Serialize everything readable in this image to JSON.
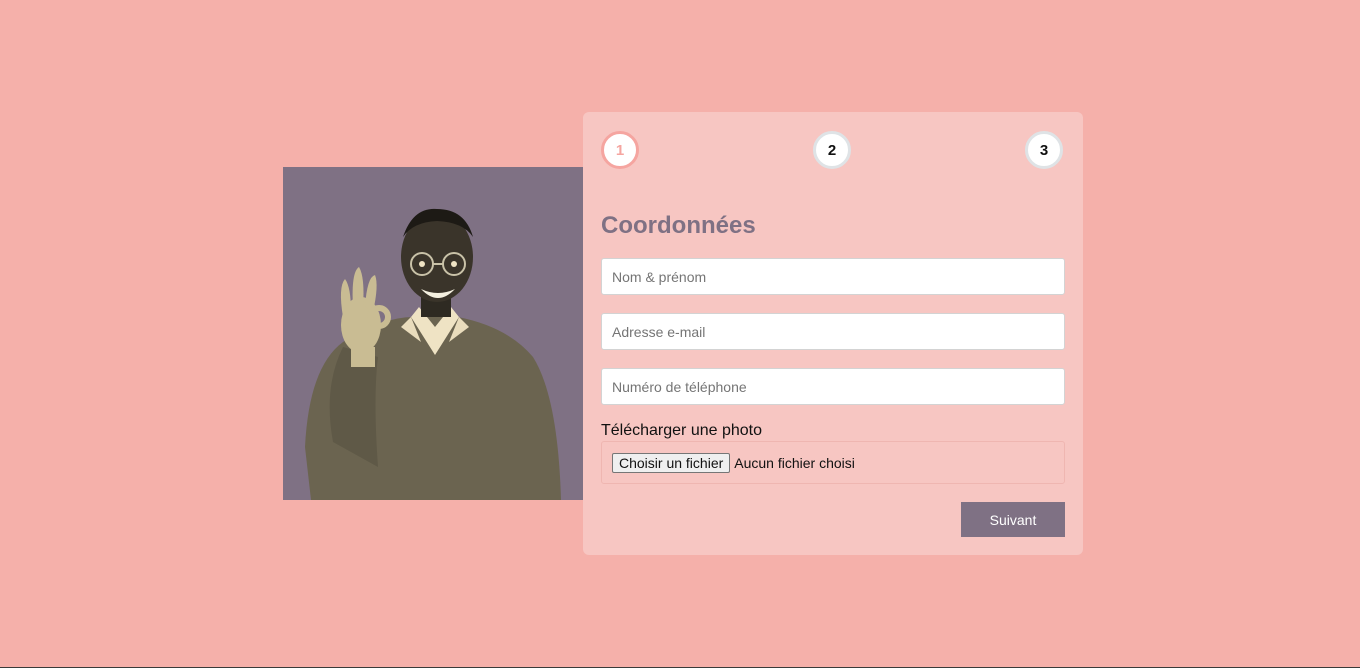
{
  "steps": [
    {
      "number": "1",
      "active": true
    },
    {
      "number": "2",
      "active": false
    },
    {
      "number": "3",
      "active": false
    }
  ],
  "form": {
    "title": "Coordonnées",
    "name_placeholder": "Nom & prénom",
    "email_placeholder": "Adresse e-mail",
    "phone_placeholder": "Numéro de téléphone",
    "upload_label": "Télécharger une photo",
    "file_button_label": "Choisir un fichier",
    "file_status": "Aucun fichier choisi",
    "next_label": "Suivant"
  },
  "colors": {
    "background": "#f5b0aa",
    "card": "#f7c6c2",
    "accent": "#7f7184",
    "active_step": "#f5a5a0"
  }
}
